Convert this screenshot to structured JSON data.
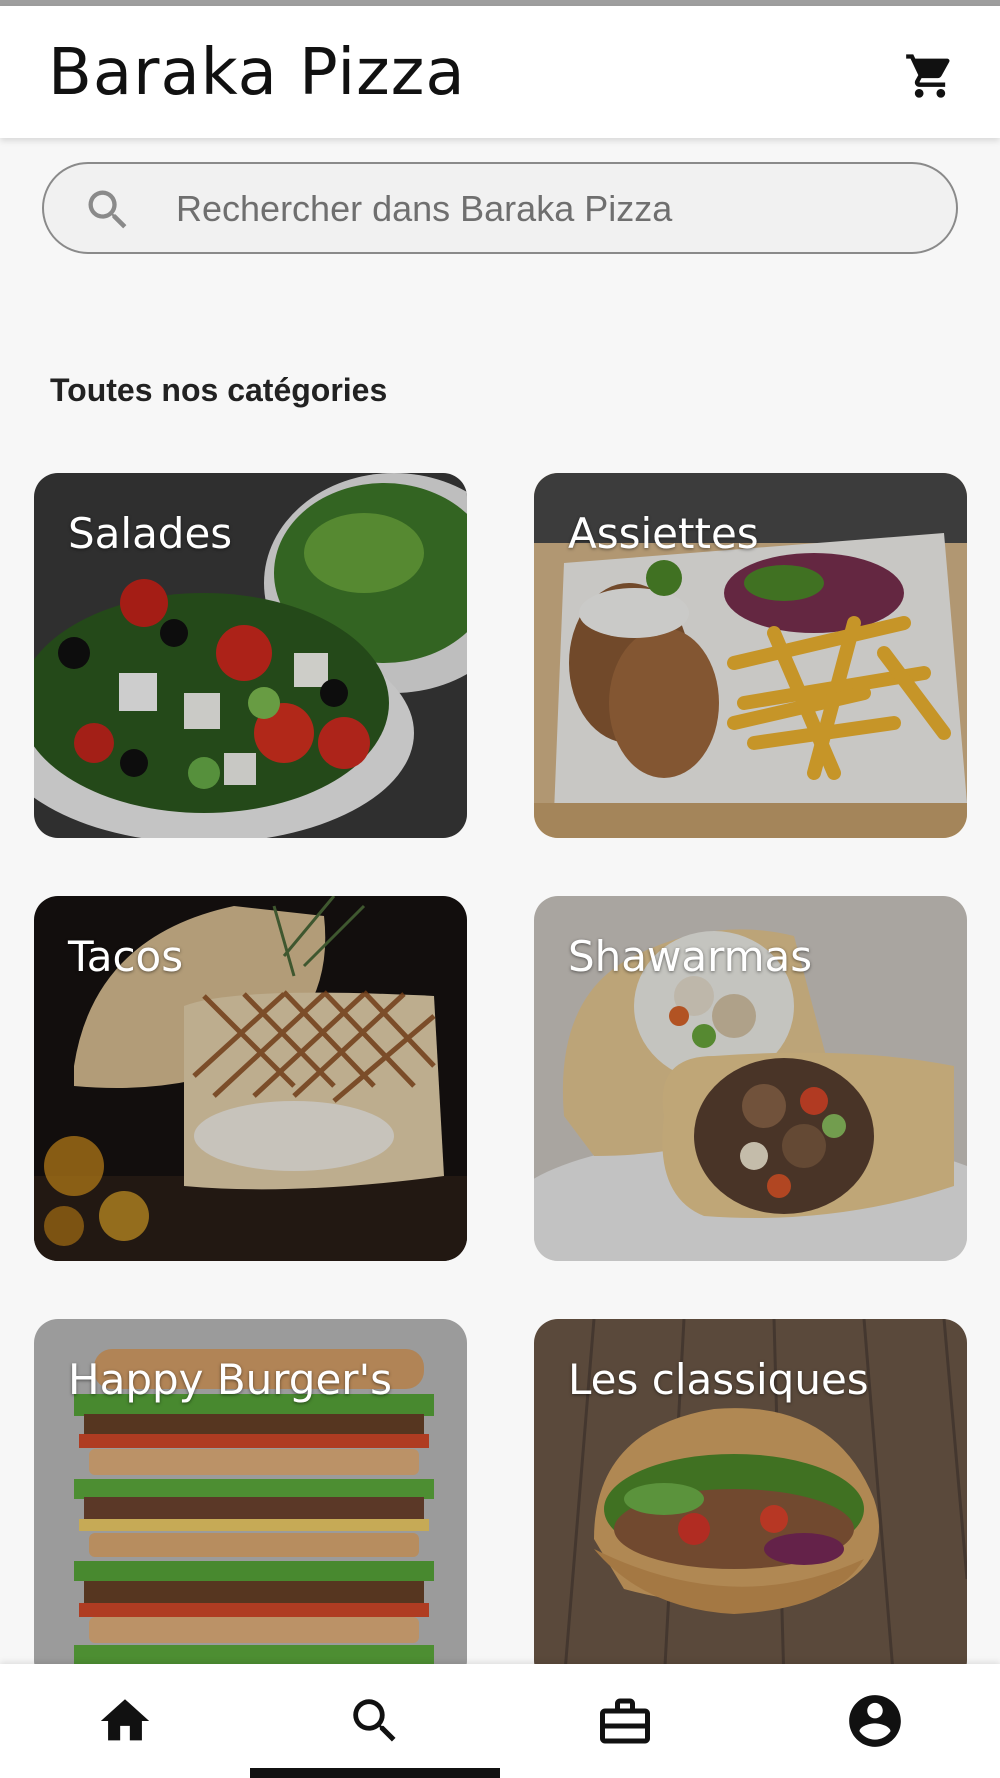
{
  "app": {
    "title": "Baraka Pizza"
  },
  "header": {
    "cart_icon": "shopping-cart-icon"
  },
  "search": {
    "placeholder": "Rechercher dans Baraka Pizza",
    "value": "",
    "icon": "search-icon"
  },
  "section": {
    "title": "Toutes nos catégories"
  },
  "categories": [
    {
      "label": "Salades",
      "image": "salad-bowl"
    },
    {
      "label": "Assiettes",
      "image": "kebab-plate-with-fries"
    },
    {
      "label": "Tacos",
      "image": "grilled-tacos"
    },
    {
      "label": "Shawarmas",
      "image": "shawarma-wraps"
    },
    {
      "label": "Happy Burger's",
      "image": "stacked-burgers"
    },
    {
      "label": "Les classiques",
      "image": "kebab-sandwich"
    }
  ],
  "bottom_nav": {
    "items": [
      {
        "icon": "home-icon",
        "selected": false
      },
      {
        "icon": "search-icon",
        "selected": true
      },
      {
        "icon": "briefcase-icon",
        "selected": false
      },
      {
        "icon": "account-circle-icon",
        "selected": false
      }
    ]
  },
  "colors": {
    "background": "#f7f7f7",
    "app_bar": "#ffffff",
    "text_primary": "#111111",
    "card_label": "#ffffff"
  }
}
